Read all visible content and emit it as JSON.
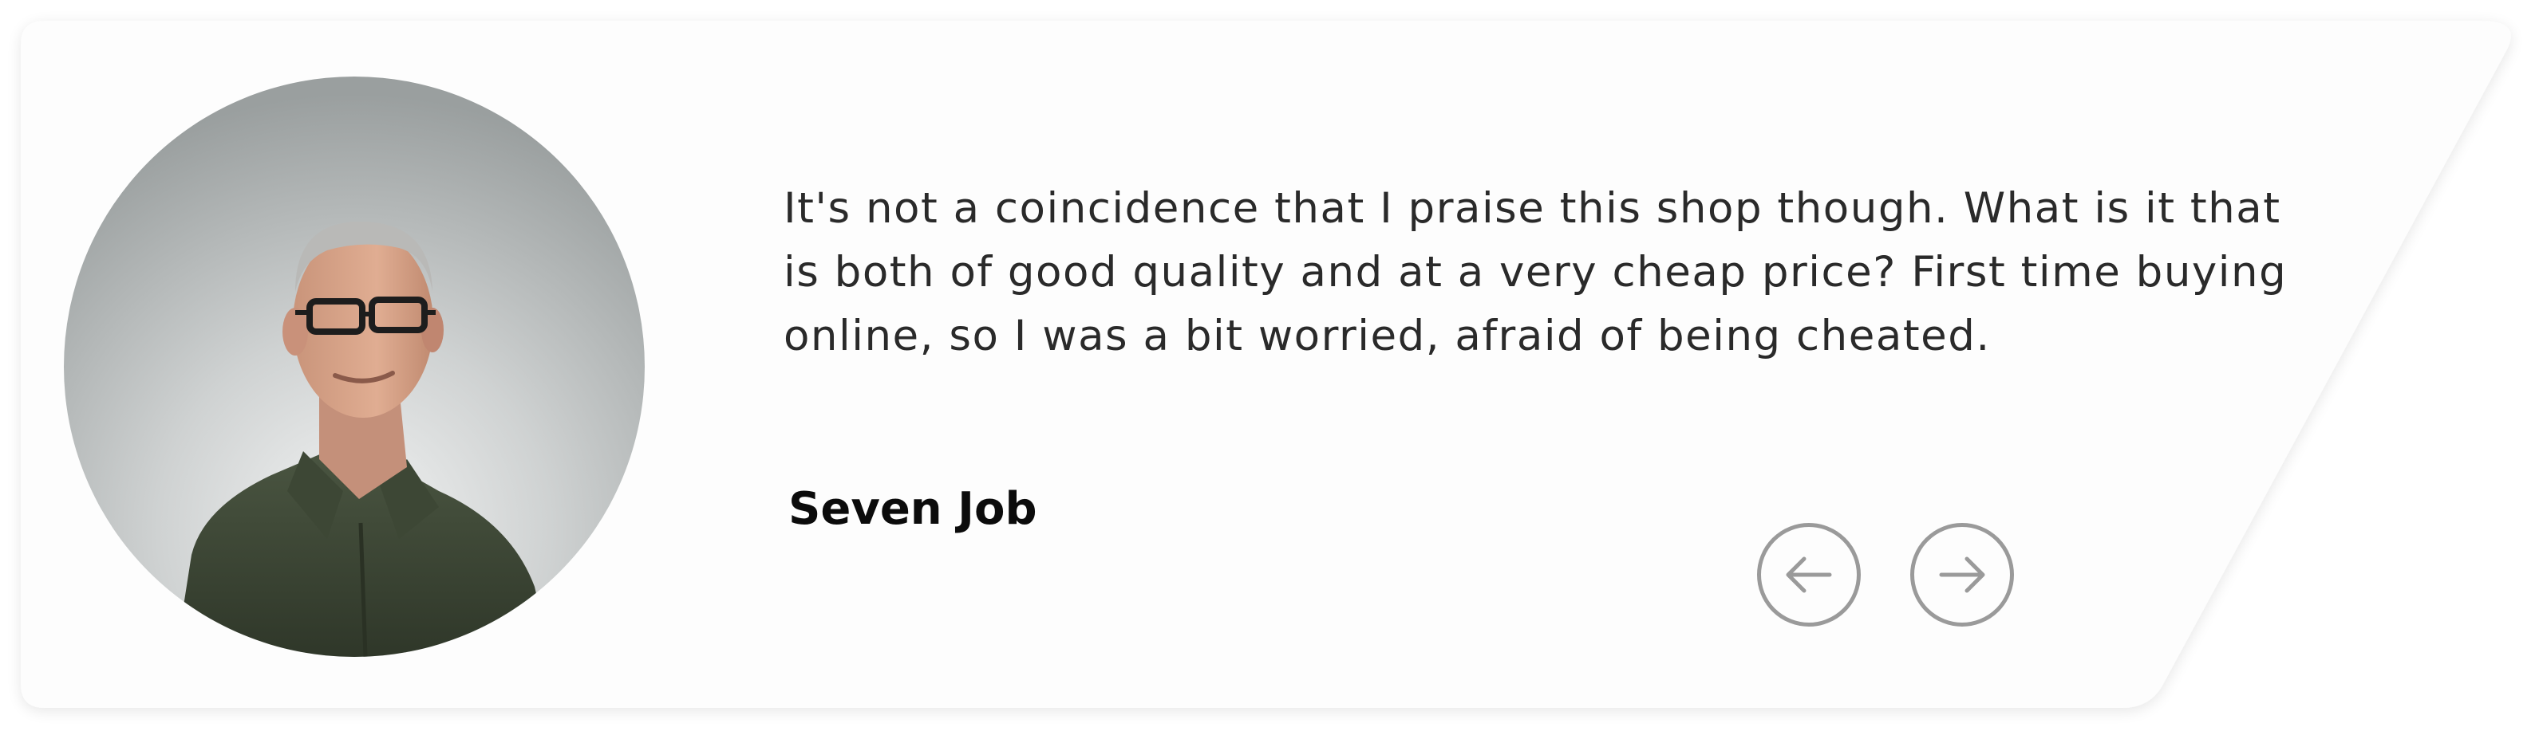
{
  "testimonial": {
    "quote": "It's not a coincidence that I praise this shop though. What is it that is both of good quality and at a very cheap price? First time buying online, so I was a bit worried, afraid of being cheated.",
    "author": "Seven Job",
    "photo": "avatar-photo"
  },
  "navigation": {
    "prev_icon": "arrow-left-icon",
    "next_icon": "arrow-right-icon"
  },
  "colors": {
    "card_background": "#fdfdfd",
    "text": "#2a2a2a",
    "author_text": "#0b0b0b",
    "nav_stroke": "#9a9a9a"
  }
}
